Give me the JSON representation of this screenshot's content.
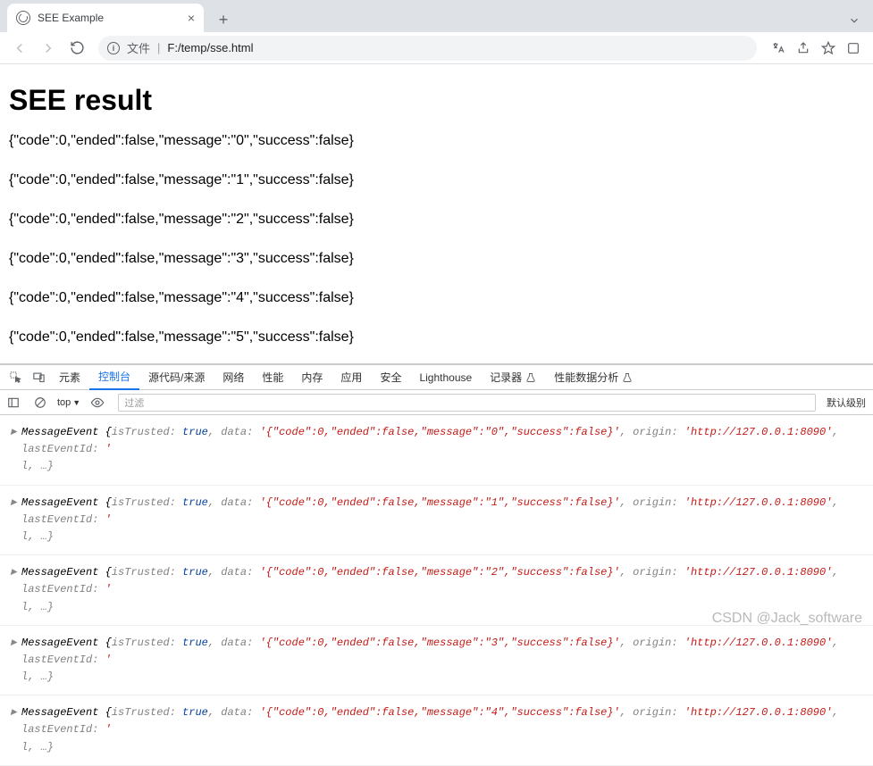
{
  "browser": {
    "tab_title": "SEE Example",
    "url_label": "文件",
    "url_path": "F:/temp/sse.html"
  },
  "page": {
    "heading": "SEE result",
    "lines": [
      "{\"code\":0,\"ended\":false,\"message\":\"0\",\"success\":false}",
      "{\"code\":0,\"ended\":false,\"message\":\"1\",\"success\":false}",
      "{\"code\":0,\"ended\":false,\"message\":\"2\",\"success\":false}",
      "{\"code\":0,\"ended\":false,\"message\":\"3\",\"success\":false}",
      "{\"code\":0,\"ended\":false,\"message\":\"4\",\"success\":false}",
      "{\"code\":0,\"ended\":false,\"message\":\"5\",\"success\":false}"
    ]
  },
  "devtools": {
    "tabs": [
      "元素",
      "控制台",
      "源代码/来源",
      "网络",
      "性能",
      "内存",
      "应用",
      "安全",
      "Lighthouse",
      "记录器",
      "性能数据分析"
    ],
    "active_tab": 1,
    "scope": "top",
    "filter_placeholder": "过滤",
    "level_label": "默认级别",
    "origin": "'http://127.0.0.1:8090'",
    "entries": [
      "'{\"code\":0,\"ended\":false,\"message\":\"0\",\"success\":false}'",
      "'{\"code\":0,\"ended\":false,\"message\":\"1\",\"success\":false}'",
      "'{\"code\":0,\"ended\":false,\"message\":\"2\",\"success\":false}'",
      "'{\"code\":0,\"ended\":false,\"message\":\"3\",\"success\":false}'",
      "'{\"code\":0,\"ended\":false,\"message\":\"4\",\"success\":false}'"
    ],
    "labels": {
      "class": "MessageEvent",
      "isTrusted": "isTrusted:",
      "true": "true",
      "data": "data:",
      "origin_lbl": "origin:",
      "lastEventId": "lastEventId:",
      "tail": "l, …}"
    }
  },
  "watermark": "CSDN @Jack_software"
}
